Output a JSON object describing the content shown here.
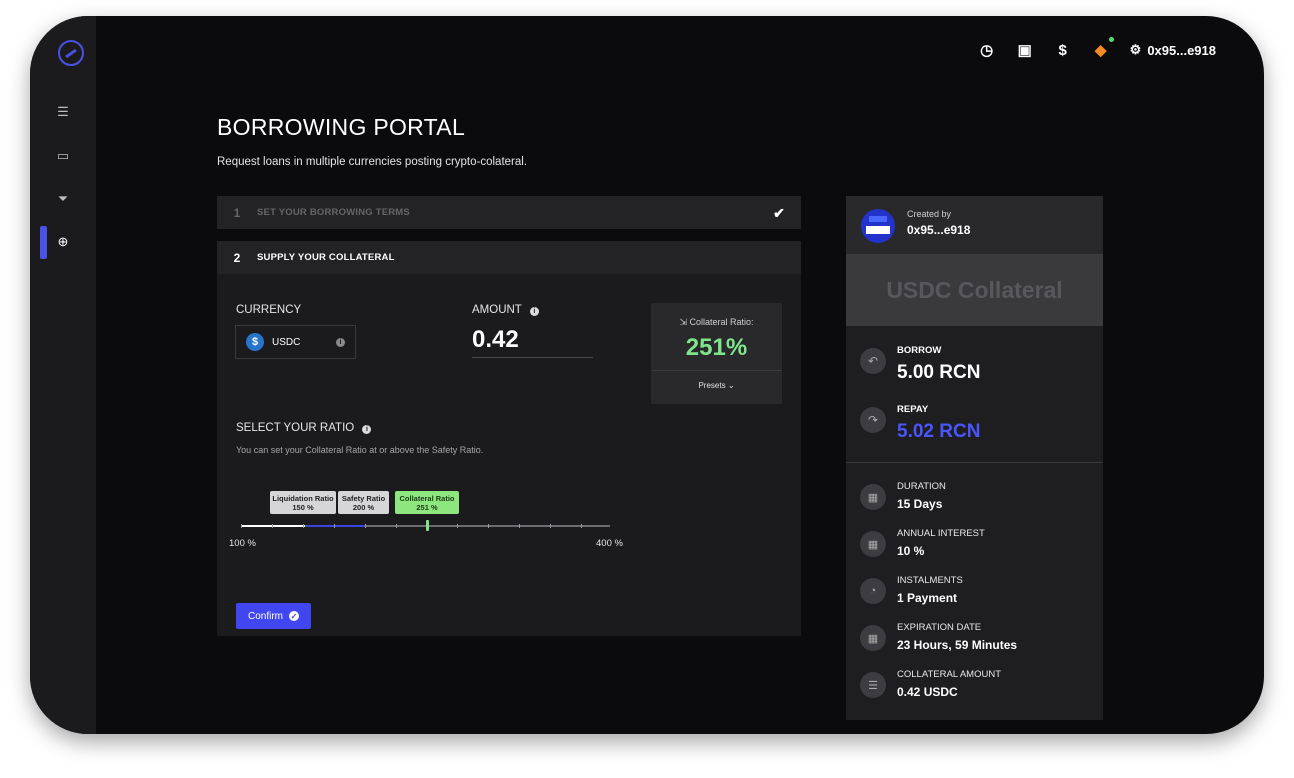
{
  "app": {
    "account": "0x95...e918"
  },
  "page": {
    "title": "BORROWING PORTAL",
    "subtitle": "Request loans in multiple currencies posting crypto-colateral."
  },
  "steps": [
    {
      "number": "1",
      "label": "SET YOUR BORROWING TERMS",
      "completed": true
    },
    {
      "number": "2",
      "label": "SUPPLY YOUR COLLATERAL",
      "completed": false
    }
  ],
  "collateral_form": {
    "currency_label": "CURRENCY",
    "currency_value": "USDC",
    "amount_label": "AMOUNT",
    "amount_value": "0.42",
    "ratio_card": {
      "label": "Collateral Ratio:",
      "value": "251%",
      "presets_label": "Presets"
    },
    "select_ratio_label": "SELECT YOUR RATIO",
    "helper_text": "You can set your Collateral Ratio at or above the Safety Ratio.",
    "slider": {
      "min_label": "100 %",
      "max_label": "400 %",
      "min": 100,
      "max": 400,
      "liquidation": {
        "label": "Liquidation Ratio",
        "value_text": "150 %",
        "value": 150
      },
      "safety": {
        "label": "Safety Ratio",
        "value_text": "200 %",
        "value": 200
      },
      "collateral": {
        "label": "Collateral Ratio",
        "value_text": "251 %",
        "value": 251
      }
    },
    "confirm_label": "Confirm"
  },
  "summary": {
    "created_by_label": "Created by",
    "created_by_address": "0x95...e918",
    "banner_title": "USDC Collateral",
    "borrow_label": "BORROW",
    "borrow_value": "5.00 RCN",
    "repay_label": "REPAY",
    "repay_value": "5.02 RCN",
    "details": [
      {
        "label": "DURATION",
        "value": "15 Days",
        "icon": "calendar-icon"
      },
      {
        "label": "ANNUAL INTEREST",
        "value": "10 %",
        "icon": "calculator-icon"
      },
      {
        "label": "INSTALMENTS",
        "value": "1 Payment",
        "icon": "pie-chart-icon"
      },
      {
        "label": "EXPIRATION DATE",
        "value": "23 Hours, 59 Minutes",
        "icon": "calendar-icon"
      },
      {
        "label": "COLLATERAL AMOUNT",
        "value": "0.42 USDC",
        "icon": "coins-icon"
      }
    ]
  },
  "colors": {
    "accent": "#4047f0",
    "ratio_green": "#7ee58a",
    "repay_blue": "#4a55ff"
  }
}
